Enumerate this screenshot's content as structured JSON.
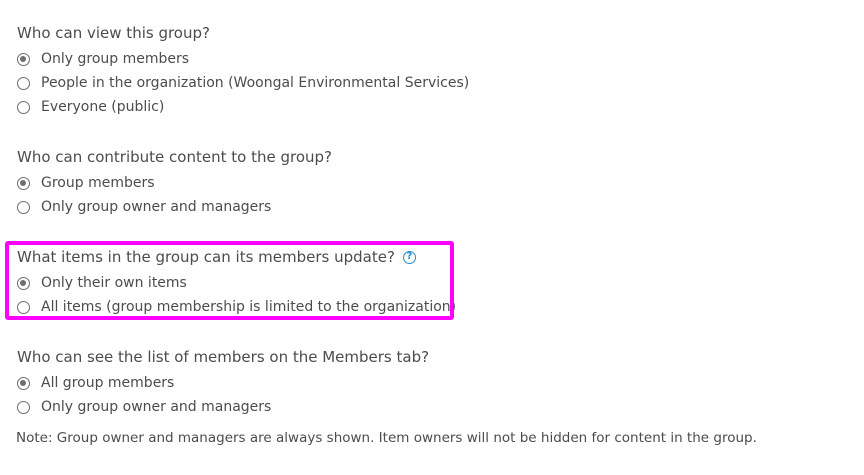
{
  "view": {
    "question": "Who can view this group?",
    "options": [
      {
        "label": "Only group members",
        "checked": true
      },
      {
        "label": "People in the organization (Woongal Environmental Services)",
        "checked": false
      },
      {
        "label": "Everyone (public)",
        "checked": false
      }
    ]
  },
  "contribute": {
    "question": "Who can contribute content to the group?",
    "options": [
      {
        "label": "Group members",
        "checked": true
      },
      {
        "label": "Only group owner and managers",
        "checked": false
      }
    ]
  },
  "update": {
    "question": "What items in the group can its members update?",
    "help_icon": "?",
    "options": [
      {
        "label": "Only their own items",
        "checked": true
      },
      {
        "label": "All items (group membership is limited to the organization)",
        "checked": false
      }
    ]
  },
  "members_list": {
    "question": "Who can see the list of members on the Members tab?",
    "options": [
      {
        "label": "All group members",
        "checked": true
      },
      {
        "label": "Only group owner and managers",
        "checked": false
      }
    ]
  },
  "note": "Note: Group owner and managers are always shown. Item owners will not be hidden for content in the group.",
  "colors": {
    "highlight": "#ff00ff",
    "help": "#2a8cc8",
    "text": "#4c4c4c"
  }
}
